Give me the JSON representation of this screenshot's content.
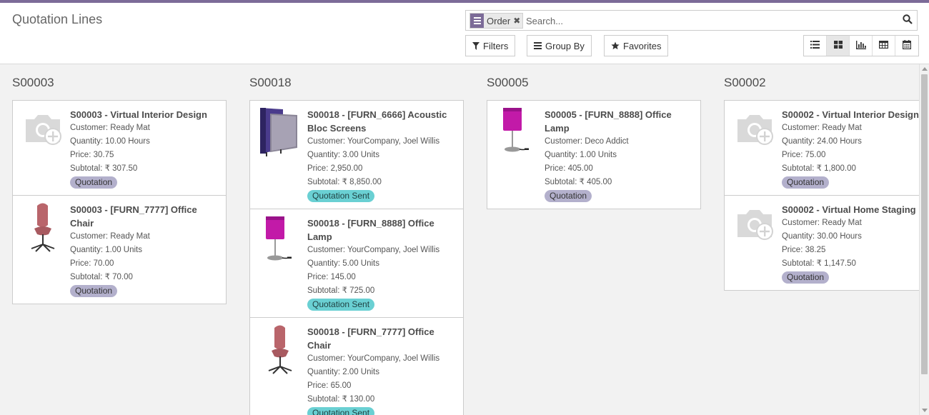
{
  "header": {
    "title": "Quotation Lines"
  },
  "search": {
    "facet_label": "Order",
    "placeholder": "Search...",
    "value": ""
  },
  "toolbar": {
    "filters_label": "Filters",
    "group_by_label": "Group By",
    "favorites_label": "Favorites",
    "views": [
      "list-view-icon",
      "kanban-view-icon",
      "graph-view-icon",
      "pivot-view-icon",
      "calendar-view-icon"
    ],
    "active_view": "kanban"
  },
  "colors": {
    "brand": "#7c6b98",
    "badge_quotation": "#b3b0cc",
    "badge_sent": "#6ad0d3"
  },
  "columns": [
    {
      "title": "S00003",
      "cards": [
        {
          "title": "S00003 - Virtual Interior Design",
          "image": "placeholder-camera-icon",
          "customer": "Customer: Ready Mat",
          "quantity": "Quantity: 10.00 Hours",
          "price": "Price: 30.75",
          "subtotal": "Subtotal: ₹ 307.50",
          "status": "Quotation"
        },
        {
          "title": "S00003 - [FURN_7777] Office Chair",
          "image": "office-chair-image",
          "customer": "Customer: Ready Mat",
          "quantity": "Quantity: 1.00 Units",
          "price": "Price: 70.00",
          "subtotal": "Subtotal: ₹ 70.00",
          "status": "Quotation"
        }
      ]
    },
    {
      "title": "S00018",
      "cards": [
        {
          "title": "S00018 - [FURN_6666] Acoustic Bloc Screens",
          "image": "acoustic-screens-image",
          "customer": "Customer: YourCompany, Joel Willis",
          "quantity": "Quantity: 3.00 Units",
          "price": "Price: 2,950.00",
          "subtotal": "Subtotal: ₹ 8,850.00",
          "status": "Quotation Sent"
        },
        {
          "title": "S00018 - [FURN_8888] Office Lamp",
          "image": "office-lamp-image",
          "customer": "Customer: YourCompany, Joel Willis",
          "quantity": "Quantity: 5.00 Units",
          "price": "Price: 145.00",
          "subtotal": "Subtotal: ₹ 725.00",
          "status": "Quotation Sent"
        },
        {
          "title": "S00018 - [FURN_7777] Office Chair",
          "image": "office-chair-image",
          "customer": "Customer: YourCompany, Joel Willis",
          "quantity": "Quantity: 2.00 Units",
          "price": "Price: 65.00",
          "subtotal": "Subtotal: ₹ 130.00",
          "status": "Quotation Sent"
        }
      ]
    },
    {
      "title": "S00005",
      "cards": [
        {
          "title": "S00005 - [FURN_8888] Office Lamp",
          "image": "office-lamp-image",
          "customer": "Customer: Deco Addict",
          "quantity": "Quantity: 1.00 Units",
          "price": "Price: 405.00",
          "subtotal": "Subtotal: ₹ 405.00",
          "status": "Quotation"
        }
      ]
    },
    {
      "title": "S00002",
      "cards": [
        {
          "title": "S00002 - Virtual Interior Design",
          "image": "placeholder-camera-icon",
          "customer": "Customer: Ready Mat",
          "quantity": "Quantity: 24.00 Hours",
          "price": "Price: 75.00",
          "subtotal": "Subtotal: ₹ 1,800.00",
          "status": "Quotation"
        },
        {
          "title": "S00002 - Virtual Home Staging",
          "image": "placeholder-camera-icon",
          "customer": "Customer: Ready Mat",
          "quantity": "Quantity: 30.00 Hours",
          "price": "Price: 38.25",
          "subtotal": "Subtotal: ₹ 1,147.50",
          "status": "Quotation"
        }
      ]
    }
  ]
}
